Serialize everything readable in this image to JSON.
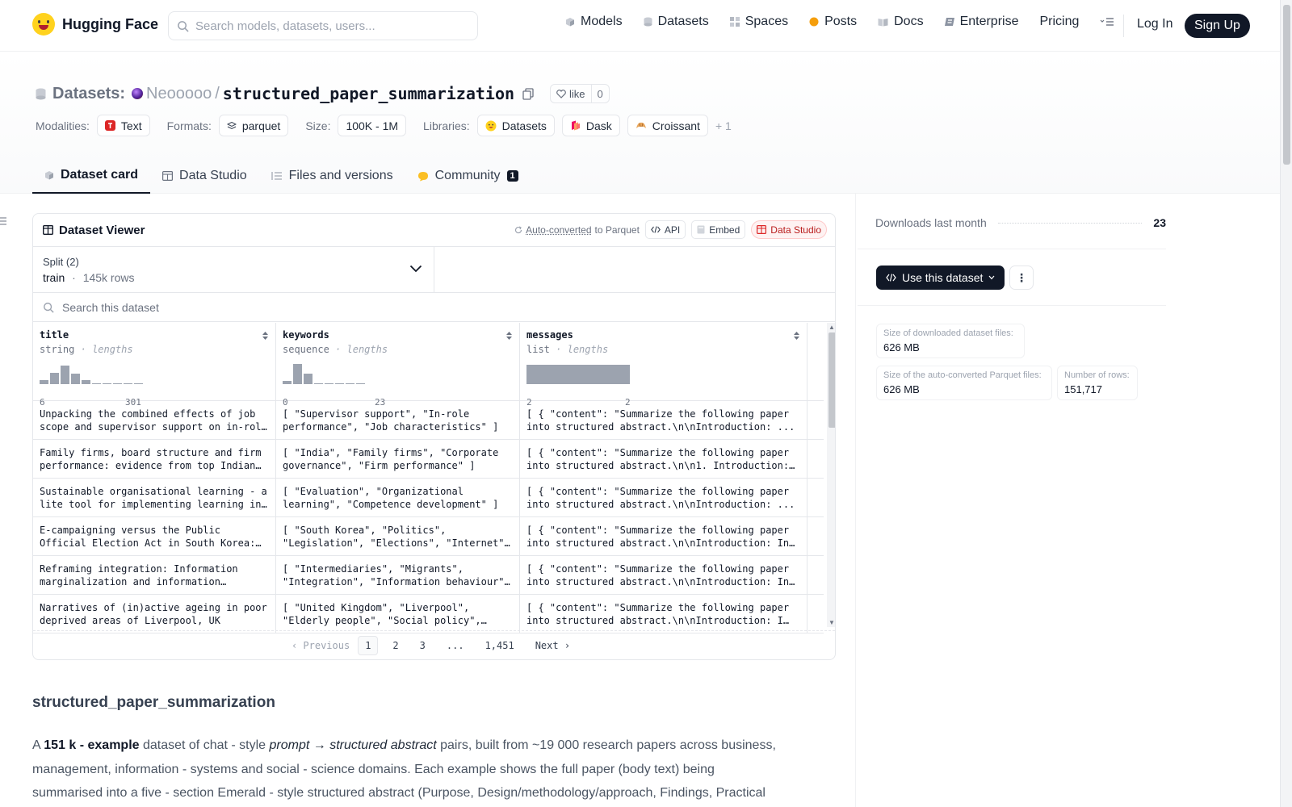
{
  "nav": {
    "brand": "Hugging Face",
    "search_placeholder": "Search models, datasets, users...",
    "links": [
      "Models",
      "Datasets",
      "Spaces",
      "Posts",
      "Docs",
      "Enterprise",
      "Pricing"
    ],
    "login": "Log In",
    "signup": "Sign Up"
  },
  "header": {
    "kind": "Datasets:",
    "owner": "Neooooo",
    "separator": "/",
    "name": "structured_paper_summarization",
    "like_label": "like",
    "like_count": "0",
    "modalities_label": "Modalities:",
    "modality": "Text",
    "formats_label": "Formats:",
    "format": "parquet",
    "size_label": "Size:",
    "size": "100K - 1M",
    "libraries_label": "Libraries:",
    "libraries": [
      "Datasets",
      "Dask",
      "Croissant"
    ],
    "more_libraries": "+ 1"
  },
  "tabs": {
    "dataset_card": "Dataset card",
    "data_studio": "Data Studio",
    "files": "Files and versions",
    "community": "Community",
    "community_count": "1"
  },
  "viewer": {
    "title": "Dataset Viewer",
    "auto_converted": "Auto-converted",
    "to_parquet": "to Parquet",
    "api": "API",
    "embed": "Embed",
    "data_studio": "Data Studio",
    "split_label": "Split (2)",
    "split_value": "train",
    "split_dot": "·",
    "split_rows": "145k rows",
    "search_placeholder": "Search this dataset",
    "columns": [
      {
        "name": "title",
        "type": "string",
        "dot": "·",
        "stat": "lengths",
        "min": "6",
        "max": "301",
        "hist": [
          0.2,
          0.55,
          0.9,
          0.5,
          0.2,
          0.05,
          0.0,
          0.0,
          0.0,
          0.0
        ]
      },
      {
        "name": "keywords",
        "type": "sequence",
        "dot": "·",
        "stat": "lengths",
        "min": "0",
        "max": "23",
        "hist": [
          0.15,
          0.95,
          0.5,
          0.05,
          0.0,
          0.0,
          0.0,
          0.0
        ]
      },
      {
        "name": "messages",
        "type": "list",
        "dot": "·",
        "stat": "lengths",
        "min": "2",
        "max": "2"
      }
    ],
    "rows": [
      [
        "Unpacking the combined effects of job scope and supervisor support on in-role performance",
        "[ \"Supervisor support\", \"In-role performance\", \"Job characteristics\" ]",
        "[ { \"content\": \"Summarize the following paper into structured abstract.\\n\\nIntroduction: ..."
      ],
      [
        "Family firms, board structure and firm performance: evidence from top Indian firms",
        "[ \"India\", \"Family firms\", \"Corporate governance\", \"Firm performance\" ]",
        "[ { \"content\": \"Summarize the following paper into structured abstract.\\n\\n1. Introduction: ..."
      ],
      [
        "Sustainable organisational learning - a lite tool for implementing learning in organisations",
        "[ \"Evaluation\", \"Organizational learning\", \"Competence development\" ]",
        "[ { \"content\": \"Summarize the following paper into structured abstract.\\n\\nIntroduction: ..."
      ],
      [
        "E-campaigning versus the Public Official Election Act in South Korea: Causes, consequences",
        "[ \"South Korea\", \"Politics\", \"Legislation\", \"Elections\", \"Internet\" ]",
        "[ { \"content\": \"Summarize the following paper into structured abstract.\\n\\nIntroduction: In ..."
      ],
      [
        "Reframing integration: Information marginalization and information resistance",
        "[ \"Intermediaries\", \"Migrants\", \"Integration\", \"Information behaviour\" ]",
        "[ { \"content\": \"Summarize the following paper into structured abstract.\\n\\nIntroduction: In ..."
      ],
      [
        "Narratives of (in)active ageing in poor deprived areas of Liverpool, UK",
        "[ \"United Kingdom\", \"Liverpool\", \"Elderly people\", \"Social policy\", \"Poverty\" ]",
        "[ { \"content\": \"Summarize the following paper into structured abstract.\\n\\nIntroduction: I see ..."
      ]
    ],
    "pager": {
      "previous": "Previous",
      "pages": [
        "1",
        "2",
        "3",
        "...",
        "1,451"
      ],
      "next": "Next"
    }
  },
  "card": {
    "heading": "structured_paper_summarization",
    "p_a": "A ",
    "p_b": "151 k - example",
    "p_c": " dataset of chat - style ",
    "p_d": "prompt → structured abstract",
    "p_e": " pairs, built from ~19 000 research papers across business, management, information - systems and social - science domains. Each example shows the full paper (body text) being summarised into a five - section Emerald - style structured abstract (Purpose, Design/methodology/approach, Findings, Practical implications,"
  },
  "rail": {
    "downloads_label": "Downloads last month",
    "downloads": "23",
    "use_button": "Use this dataset",
    "stats": [
      {
        "label": "Size of downloaded dataset files:",
        "value": "626 MB"
      },
      {
        "label": "Size of the auto-converted Parquet files:",
        "value": "626 MB"
      },
      {
        "label": "Number of rows:",
        "value": "151,717"
      }
    ]
  },
  "colors": {
    "brand_yellow": "#ffd21e",
    "dark": "#111827",
    "studio_red": "#b91c1c"
  }
}
